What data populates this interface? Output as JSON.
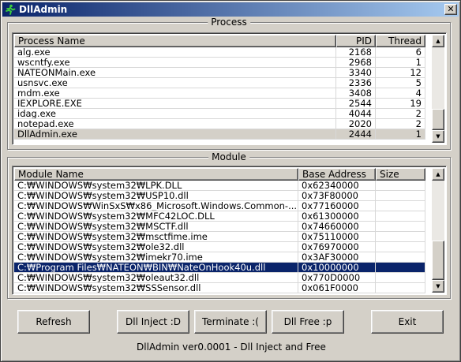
{
  "window": {
    "title": "DllAdmin",
    "close_glyph": "✕",
    "icon": "running-man-icon"
  },
  "process_group": {
    "label": "Process",
    "columns": [
      "Process Name",
      "PID",
      "Thread"
    ],
    "rows": [
      {
        "name": "alg.exe",
        "pid": "2168",
        "thread": "6"
      },
      {
        "name": "wscntfy.exe",
        "pid": "2968",
        "thread": "1"
      },
      {
        "name": "NATEONMain.exe",
        "pid": "3340",
        "thread": "12"
      },
      {
        "name": "usnsvc.exe",
        "pid": "2336",
        "thread": "5"
      },
      {
        "name": "mdm.exe",
        "pid": "3408",
        "thread": "4"
      },
      {
        "name": "IEXPLORE.EXE",
        "pid": "2544",
        "thread": "19"
      },
      {
        "name": "idag.exe",
        "pid": "4044",
        "thread": "2"
      },
      {
        "name": "notepad.exe",
        "pid": "2020",
        "thread": "2"
      },
      {
        "name": "DllAdmin.exe",
        "pid": "2444",
        "thread": "1"
      }
    ]
  },
  "module_group": {
    "label": "Module",
    "columns": [
      "Module Name",
      "Base Address",
      "Size"
    ],
    "rows": [
      {
        "name": "C:₩WINDOWS₩system32₩LPK.DLL",
        "base": "0x62340000",
        "size": ""
      },
      {
        "name": "C:₩WINDOWS₩system32₩USP10.dll",
        "base": "0x73F80000",
        "size": ""
      },
      {
        "name": "C:₩WINDOWS₩WinSxS₩x86_Microsoft.Windows.Common-...",
        "base": "0x77160000",
        "size": ""
      },
      {
        "name": "C:₩WINDOWS₩system32₩MFC42LOC.DLL",
        "base": "0x61300000",
        "size": ""
      },
      {
        "name": "C:₩WINDOWS₩system32₩MSCTF.dll",
        "base": "0x74660000",
        "size": ""
      },
      {
        "name": "C:₩WINDOWS₩system32₩msctfime.ime",
        "base": "0x75110000",
        "size": ""
      },
      {
        "name": "C:₩WINDOWS₩system32₩ole32.dll",
        "base": "0x76970000",
        "size": ""
      },
      {
        "name": "C:₩WINDOWS₩system32₩imekr70.ime",
        "base": "0x3AF30000",
        "size": ""
      },
      {
        "name": "C:₩Program Files₩NATEON₩BIN₩NateOnHook40u.dll",
        "base": "0x10000000",
        "size": ""
      },
      {
        "name": "C:₩WINDOWS₩system32₩oleaut32.dll",
        "base": "0x770D0000",
        "size": ""
      },
      {
        "name": "C:₩WINDOWS₩system32₩SSSensor.dll",
        "base": "0x061F0000",
        "size": ""
      }
    ]
  },
  "buttons": {
    "refresh": "Refresh",
    "dll_inject": "Dll Inject  :D",
    "terminate": "Terminate  :(",
    "dll_free": "Dll Free  :p",
    "exit": "Exit"
  },
  "status": "DllAdmin ver0.0001 - Dll Inject and Free",
  "colors": {
    "selection": "#0a246a",
    "title_start": "#0a246a",
    "title_end": "#a6caf0",
    "face": "#d4d0c8"
  }
}
